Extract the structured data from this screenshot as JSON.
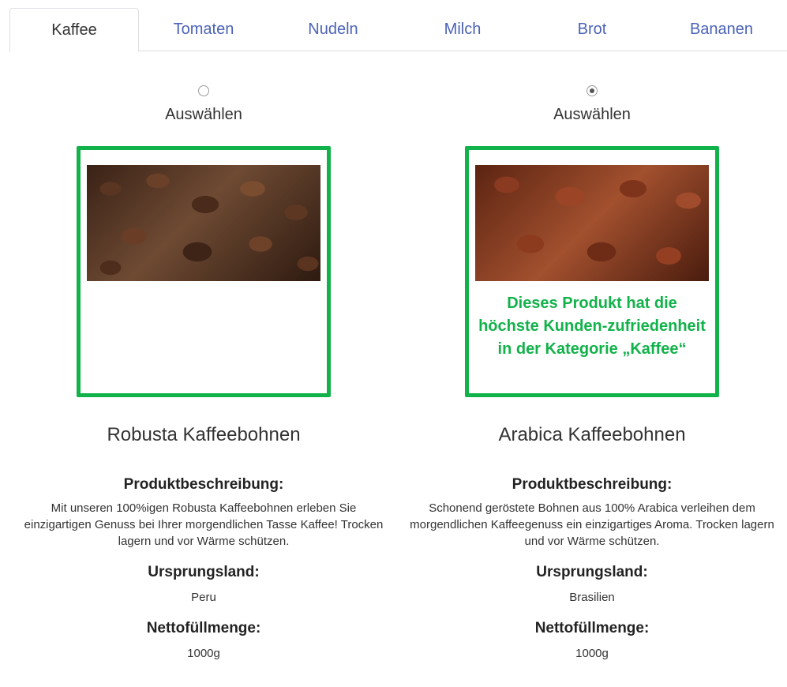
{
  "tabs": [
    {
      "label": "Kaffee",
      "active": true
    },
    {
      "label": "Tomaten",
      "active": false
    },
    {
      "label": "Nudeln",
      "active": false
    },
    {
      "label": "Milch",
      "active": false
    },
    {
      "label": "Brot",
      "active": false
    },
    {
      "label": "Bananen",
      "active": false
    }
  ],
  "colors": {
    "accent_green": "#12b24a",
    "tab_link": "#4c63b6"
  },
  "products": [
    {
      "select_label": "Auswählen",
      "selected": false,
      "image": "coffee-beans-dark",
      "promo": "",
      "name": "Robusta Kaffeebohnen",
      "desc_heading": "Produktbeschreibung:",
      "description": "Mit unseren 100%igen Robusta Kaffeebohnen erleben Sie einzigartigen Genuss bei Ihrer morgendlichen Tasse Kaffee! Trocken lagern und vor Wärme schützen.",
      "origin_heading": "Ursprungsland:",
      "origin": "Peru",
      "net_heading": "Nettofüllmenge:",
      "net": "1000g"
    },
    {
      "select_label": "Auswählen",
      "selected": true,
      "image": "coffee-beans-light",
      "promo": "Dieses Produkt hat die höchste Kunden-zufriedenheit in der Kategorie „Kaffee“",
      "name": "Arabica Kaffeebohnen",
      "desc_heading": "Produktbeschreibung:",
      "description": "Schonend geröstete Bohnen aus 100% Arabica verleihen dem morgendlichen Kaffeegenuss ein einzigartiges Aroma. Trocken lagern und vor Wärme schützen.",
      "origin_heading": "Ursprungsland:",
      "origin": "Brasilien",
      "net_heading": "Nettofüllmenge:",
      "net": "1000g"
    }
  ]
}
